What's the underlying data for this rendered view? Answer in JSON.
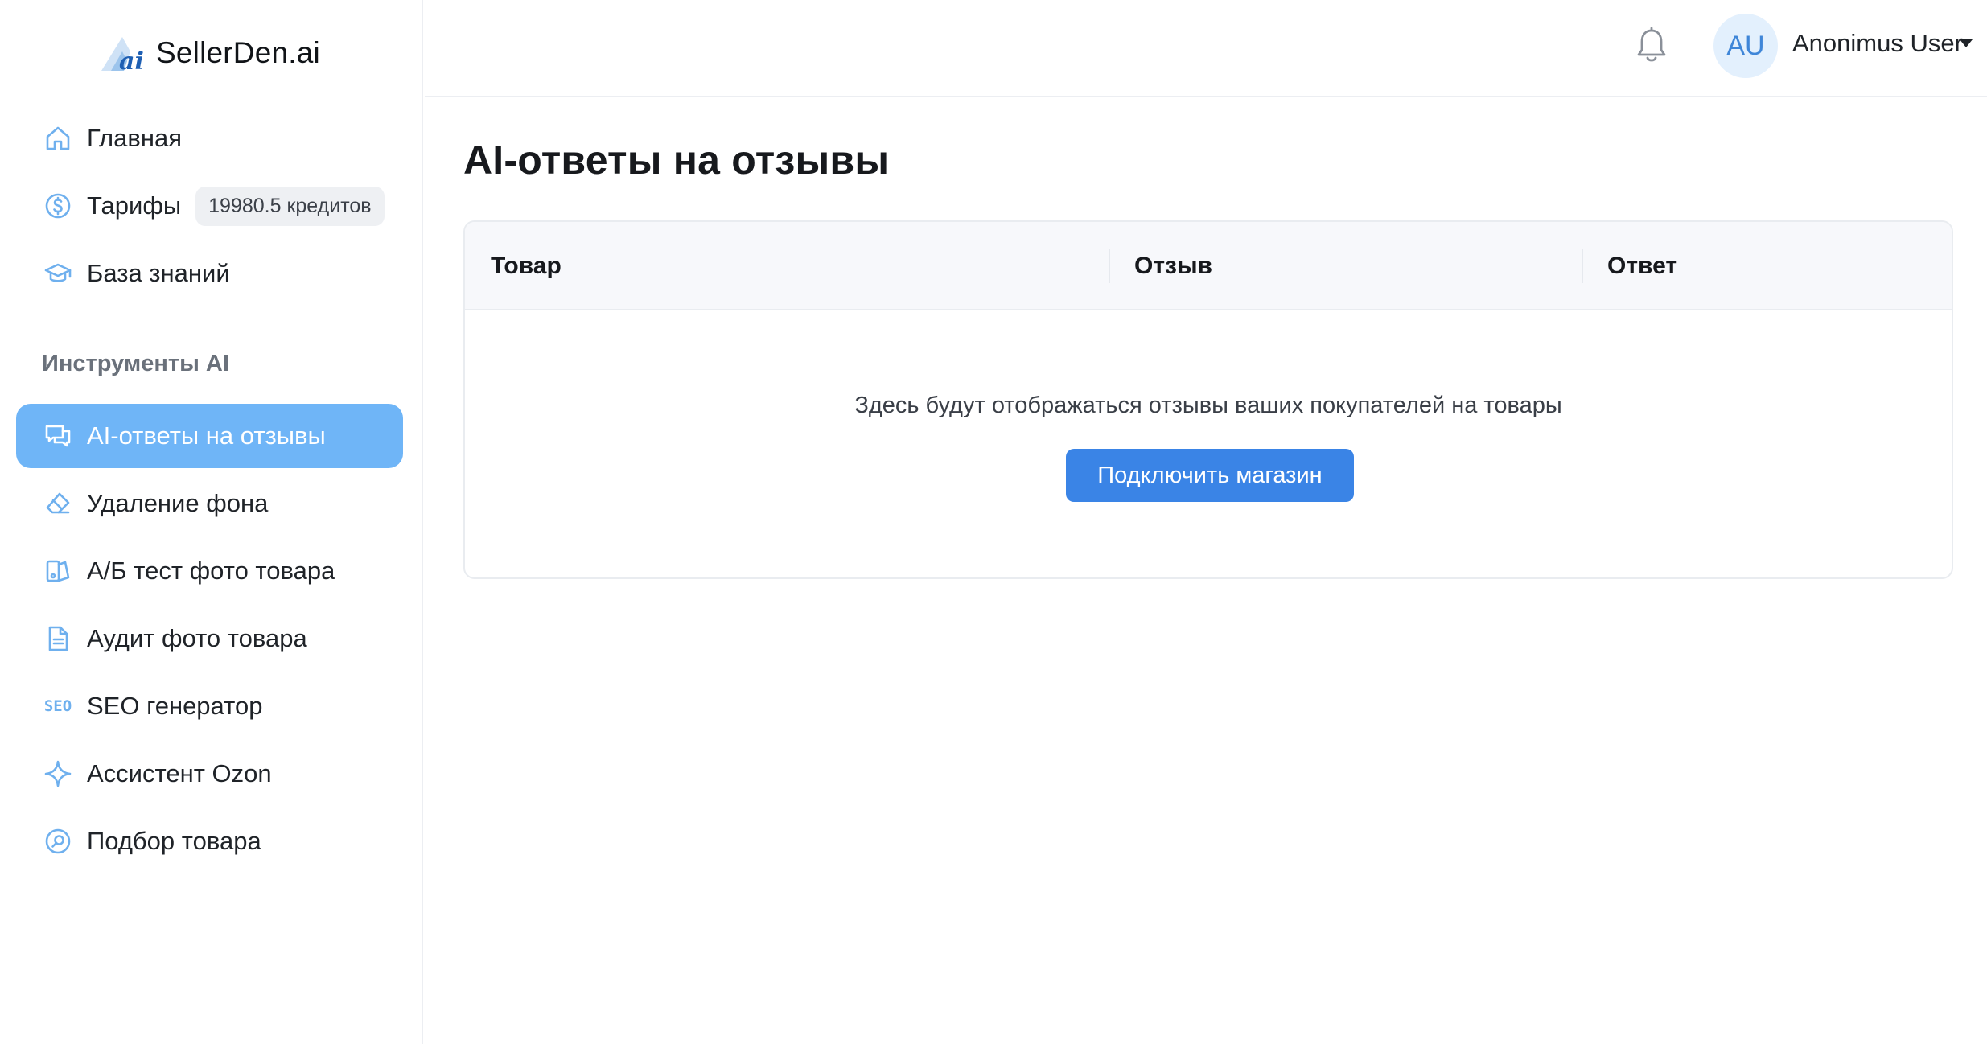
{
  "brand": {
    "name": "SellerDen.ai",
    "logo_mark": "ai",
    "logo_icon": "mountain-ai-logo",
    "accent_color": "#6fb5f7",
    "primary_button_color": "#3a84e6"
  },
  "sidebar": {
    "main_items": [
      {
        "label": "Главная",
        "icon": "home-icon"
      },
      {
        "label": "Тарифы",
        "icon": "dollar-icon",
        "badge": "19980.5 кредитов"
      },
      {
        "label": "База знаний",
        "icon": "graduation-cap-icon"
      }
    ],
    "section_title": "Инструменты AI",
    "tool_items": [
      {
        "label": "AI-ответы на отзывы",
        "icon": "chat-bubbles-icon",
        "active": true
      },
      {
        "label": "Удаление фона",
        "icon": "eraser-icon"
      },
      {
        "label": "А/Б тест фото товара",
        "icon": "ab-test-icon"
      },
      {
        "label": "Аудит фото товара",
        "icon": "document-icon"
      },
      {
        "label": "SEO генератор",
        "icon": "seo-icon",
        "icon_text": "SEO"
      },
      {
        "label": "Ассистент Ozon",
        "icon": "sparkle-icon"
      },
      {
        "label": "Подбор товара",
        "icon": "search-circle-icon"
      }
    ]
  },
  "header": {
    "notification_icon": "bell-icon",
    "avatar_initials": "AU",
    "user_name": "Anonimus User",
    "menu_icon": "caret-down-icon"
  },
  "main": {
    "page_title": "AI-ответы на отзывы",
    "table": {
      "columns": [
        "Товар",
        "Отзыв",
        "Ответ"
      ],
      "empty_message": "Здесь будут отображаться отзывы ваших покупателей на товары",
      "connect_button": "Подключить магазин"
    }
  }
}
